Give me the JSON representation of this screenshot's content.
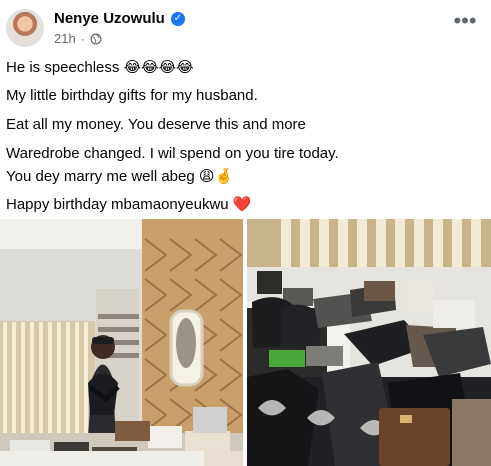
{
  "post": {
    "author": "Nenye Uzowulu",
    "time": "21h",
    "dot": "·",
    "lines": [
      {
        "text": "He is speechless",
        "emoji": "😂😂😂😂"
      },
      {
        "text": "My little birthday gifts for my husband."
      },
      {
        "text": "Eat all my money. You deserve this and more"
      },
      {
        "text": "Waredrobe changed. I wil spend on you tire today."
      },
      {
        "text": "You dey marry me well abeg",
        "emoji": "😩🤞"
      },
      {
        "text": "Happy birthday mbamaonyeukwu",
        "emoji": "❤️"
      }
    ]
  },
  "icons": {
    "verified": "verified-icon",
    "globe": "globe-icon",
    "more": "more-options-icon"
  },
  "colors": {
    "verified": "#1877f2",
    "secondary_text": "#65676b",
    "heart": "#e41e3f"
  }
}
